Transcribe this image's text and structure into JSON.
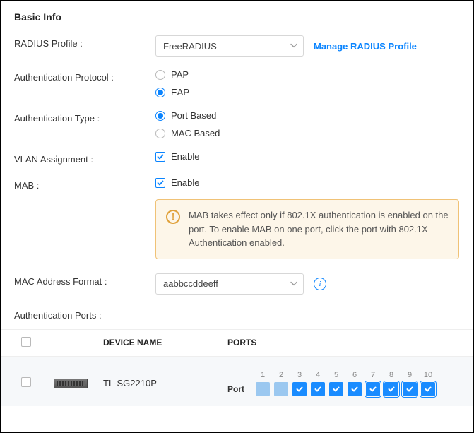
{
  "section_title": "Basic Info",
  "radius_profile": {
    "label": "RADIUS Profile :",
    "selected": "FreeRADIUS",
    "manage_link": "Manage RADIUS Profile"
  },
  "auth_protocol": {
    "label": "Authentication Protocol :",
    "options": {
      "pap": "PAP",
      "eap": "EAP"
    },
    "selected": "eap"
  },
  "auth_type": {
    "label": "Authentication Type :",
    "options": {
      "port": "Port Based",
      "mac": "MAC Based"
    },
    "selected": "port"
  },
  "vlan_assignment": {
    "label": "VLAN Assignment :",
    "checkbox_label": "Enable",
    "checked": true
  },
  "mab": {
    "label": "MAB :",
    "checkbox_label": "Enable",
    "checked": true,
    "alert": "MAB takes effect only if 802.1X authentication is enabled on the port. To enable MAB on one port, click the port with 802.1X Authentication enabled."
  },
  "mac_format": {
    "label": "MAC Address Format :",
    "selected": "aabbccddeeff"
  },
  "auth_ports_label": "Authentication Ports :",
  "table": {
    "headers": {
      "device_name": "DEVICE NAME",
      "ports": "PORTS"
    },
    "row": {
      "device_name": "TL-SG2210P",
      "port_row_label": "Port",
      "port_numbers": [
        "1",
        "2",
        "3",
        "4",
        "5",
        "6",
        "7",
        "8",
        "9",
        "10"
      ],
      "port_states": [
        "off",
        "off",
        "on",
        "on",
        "on",
        "on",
        "on-out",
        "on-out",
        "on-out",
        "on-out"
      ]
    }
  }
}
